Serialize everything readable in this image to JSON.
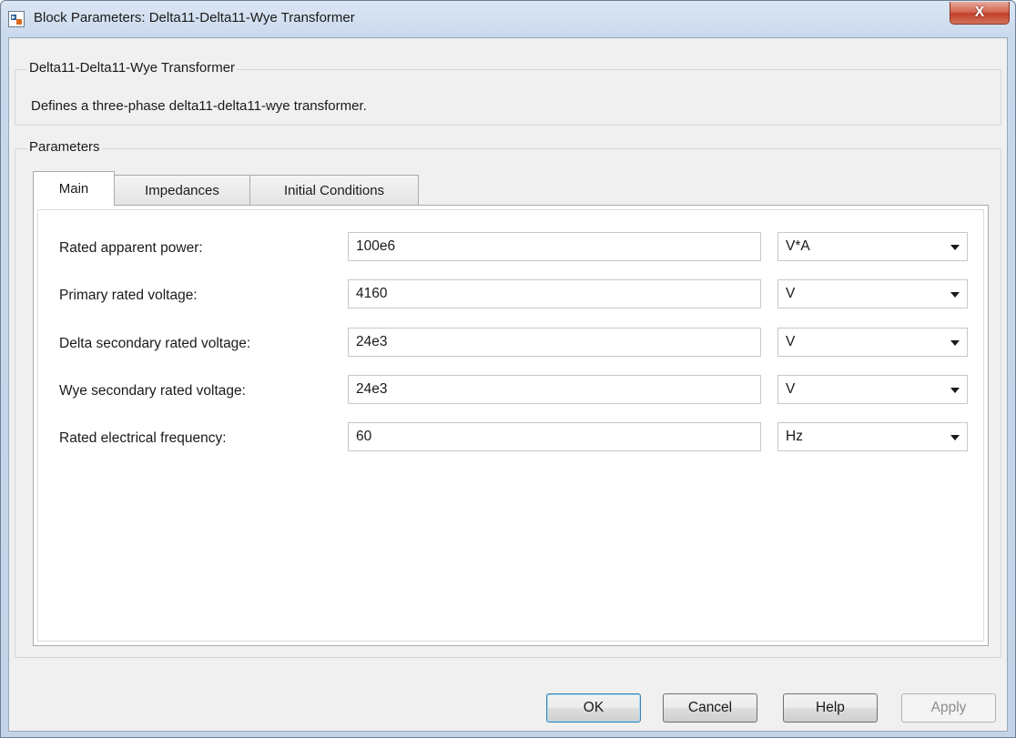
{
  "window": {
    "title": "Block Parameters: Delta11-Delta11-Wye Transformer",
    "close_glyph": "X"
  },
  "description": {
    "group_title": "Delta11-Delta11-Wye Transformer",
    "text": "Defines a three-phase delta11-delta11-wye transformer."
  },
  "parameters": {
    "group_title": "Parameters",
    "tabs": [
      {
        "label": "Main",
        "active": true
      },
      {
        "label": "Impedances",
        "active": false
      },
      {
        "label": "Initial Conditions",
        "active": false
      }
    ],
    "rows": [
      {
        "label": "Rated apparent power:",
        "value": "100e6",
        "unit": "V*A"
      },
      {
        "label": "Primary rated voltage:",
        "value": "4160",
        "unit": "V"
      },
      {
        "label": "Delta secondary rated voltage:",
        "value": "24e3",
        "unit": "V"
      },
      {
        "label": "Wye secondary rated voltage:",
        "value": "24e3",
        "unit": "V"
      },
      {
        "label": "Rated electrical frequency:",
        "value": "60",
        "unit": "Hz"
      }
    ]
  },
  "buttons": {
    "ok": "OK",
    "cancel": "Cancel",
    "help": "Help",
    "apply": "Apply"
  }
}
